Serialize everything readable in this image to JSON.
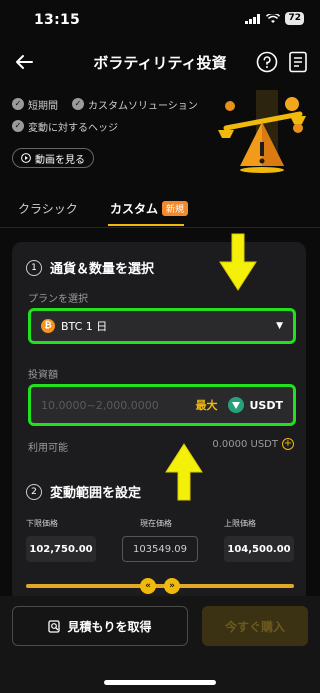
{
  "status": {
    "time": "13:15",
    "battery": "72"
  },
  "nav": {
    "title": "ボラティリティ投資"
  },
  "features": [
    "短期間",
    "カスタムソリューション",
    "変動に対するヘッジ"
  ],
  "video_button": "動画を見る",
  "tabs": {
    "classic": "クラシック",
    "custom": "カスタム",
    "new_badge": "新規"
  },
  "section1": {
    "num": "1",
    "title": "通貨＆数量を選択",
    "plan_label": "プランを選択",
    "plan_value": "BTC 1 日",
    "amount_label": "投資額",
    "amount_placeholder": "10.0000~2,000.0000",
    "max_label": "最大",
    "currency": "USDT",
    "available_label": "利用可能",
    "available_value": "0.0000 USDT"
  },
  "section2": {
    "num": "2",
    "title": "変動範囲を設定",
    "lower_label": "下限価格",
    "current_label": "現在価格",
    "upper_label": "上限価格",
    "lower_value": "102,750.00",
    "current_value": "103549.09",
    "upper_value": "104,500.00"
  },
  "bottom": {
    "quote": "見積もりを取得",
    "buy": "今すぐ購入"
  },
  "colors": {
    "accent": "#f0b90b",
    "highlight": "#22e01e",
    "bg": "#0b0b0b",
    "card": "#1c1c1e"
  }
}
